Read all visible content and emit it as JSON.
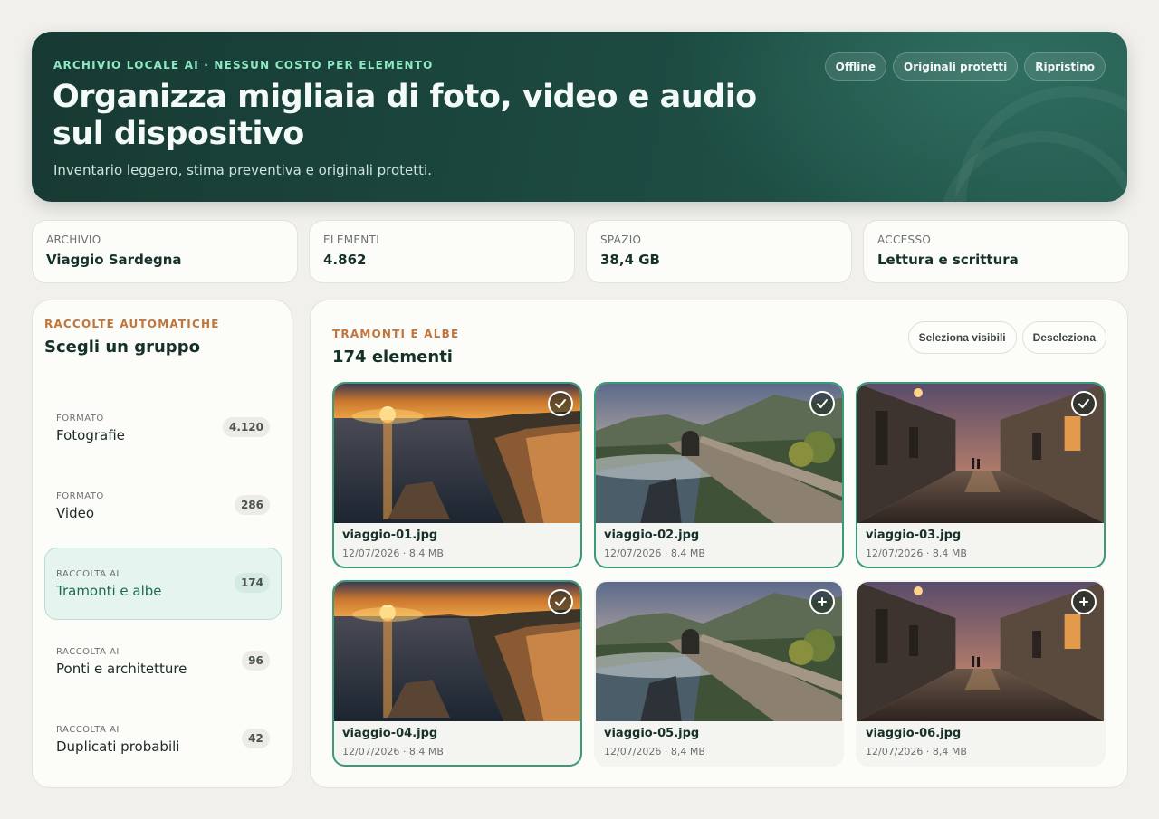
{
  "hero": {
    "eyebrow": "ARCHIVIO LOCALE AI · NESSUN COSTO PER ELEMENTO",
    "title": "Organizza migliaia di foto, video e audio sul dispositivo",
    "subtitle": "Inventario leggero, stima preventiva e originali protetti.",
    "badges": [
      "Offline",
      "Originali protetti",
      "Ripristino"
    ]
  },
  "stats": [
    {
      "label": "ARCHIVIO",
      "value": "Viaggio Sardegna"
    },
    {
      "label": "ELEMENTI",
      "value": "4.862"
    },
    {
      "label": "SPAZIO",
      "value": "38,4 GB"
    },
    {
      "label": "ACCESSO",
      "value": "Lettura e scrittura"
    }
  ],
  "sidebar": {
    "eyebrow": "RACCOLTE AUTOMATICHE",
    "title": "Scegli un gruppo",
    "groups": [
      {
        "kicker": "FORMATO",
        "name": "Fotografie",
        "count": "4.120",
        "active": false
      },
      {
        "kicker": "FORMATO",
        "name": "Video",
        "count": "286",
        "active": false
      },
      {
        "kicker": "RACCOLTA AI",
        "name": "Tramonti e albe",
        "count": "174",
        "active": true
      },
      {
        "kicker": "RACCOLTA AI",
        "name": "Ponti e architetture",
        "count": "96",
        "active": false
      },
      {
        "kicker": "RACCOLTA AI",
        "name": "Duplicati probabili",
        "count": "42",
        "active": false
      }
    ]
  },
  "main": {
    "eyebrow": "TRAMONTI E ALBE",
    "title": "174 elementi",
    "select_visible_label": "Seleziona visibili",
    "deselect_label": "Deseleziona",
    "items": [
      {
        "name": "viaggio-01.jpg",
        "meta": "12/07/2026 · 8,4 MB",
        "selected": true,
        "scene": "sunset-cliffs"
      },
      {
        "name": "viaggio-02.jpg",
        "meta": "12/07/2026 · 8,4 MB",
        "selected": true,
        "scene": "stone-bridge"
      },
      {
        "name": "viaggio-03.jpg",
        "meta": "12/07/2026 · 8,4 MB",
        "selected": true,
        "scene": "old-town-street"
      },
      {
        "name": "viaggio-04.jpg",
        "meta": "12/07/2026 · 8,4 MB",
        "selected": true,
        "scene": "sunset-cliffs"
      },
      {
        "name": "viaggio-05.jpg",
        "meta": "12/07/2026 · 8,4 MB",
        "selected": false,
        "scene": "stone-bridge"
      },
      {
        "name": "viaggio-06.jpg",
        "meta": "12/07/2026 · 8,4 MB",
        "selected": false,
        "scene": "old-town-street"
      }
    ]
  },
  "colors": {
    "hero_bg": "#1c4a41",
    "accent_green": "#3a9b79",
    "eyebrow_orange": "#c2753a",
    "eyebrow_mint": "#8fe8c4"
  }
}
